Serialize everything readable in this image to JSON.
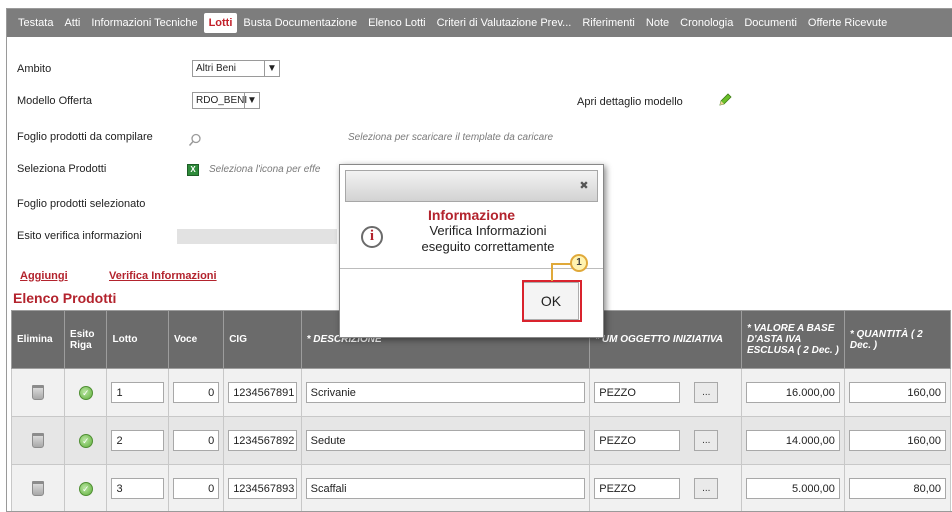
{
  "tabs": [
    "Testata",
    "Atti",
    "Informazioni Tecniche",
    "Lotti",
    "Busta Documentazione",
    "Elenco Lotti",
    "Criteri di Valutazione Prev...",
    "Riferimenti",
    "Note",
    "Cronologia",
    "Documenti",
    "Offerte Ricevute"
  ],
  "form": {
    "ambito_label": "Ambito",
    "ambito_value": "Altri Beni",
    "modello_label": "Modello Offerta",
    "modello_value": "RDO_BENI",
    "apri_dettaglio_label": "Apri dettaglio modello",
    "foglio_compilare_label": "Foglio prodotti da compilare",
    "foglio_compilare_hint": "Seleziona per scaricare il template da caricare",
    "seleziona_prodotti_label": "Seleziona Prodotti",
    "seleziona_prodotti_hint": "Seleziona l'icona per effe",
    "foglio_selezionato_label": "Foglio prodotti selezionato",
    "esito_label": "Esito verifica informazioni"
  },
  "actions": {
    "aggiungi": "Aggiungi",
    "verifica": "Verifica Informazioni"
  },
  "section_title": "Elenco Prodotti",
  "table": {
    "headers": [
      "Elimina",
      "Esito Riga",
      "Lotto",
      "Voce",
      "CIG",
      "* DESCRIZIONE",
      "* UM OGGETTO INIZIATIVA",
      "* VALORE A BASE D'ASTA IVA ESCLUSA ( 2 Dec. )",
      "* QUANTITÀ ( 2 Dec. )"
    ],
    "rows": [
      {
        "lotto": "1",
        "voce": "0",
        "cig": "1234567891",
        "descrizione": "Scrivanie",
        "um": "PEZZO",
        "valore": "16.000,00",
        "quantita": "160,00"
      },
      {
        "lotto": "2",
        "voce": "0",
        "cig": "1234567892",
        "descrizione": "Sedute",
        "um": "PEZZO",
        "valore": "14.000,00",
        "quantita": "160,00"
      },
      {
        "lotto": "3",
        "voce": "0",
        "cig": "1234567893",
        "descrizione": "Scaffali",
        "um": "PEZZO",
        "valore": "5.000,00",
        "quantita": "80,00"
      }
    ]
  },
  "modal": {
    "title": "Informazione",
    "message_line1": "Verifica Informazioni",
    "message_line2": "eseguito correttamente",
    "ok_label": "OK",
    "close_glyph": "✖"
  },
  "callout_number": "1"
}
